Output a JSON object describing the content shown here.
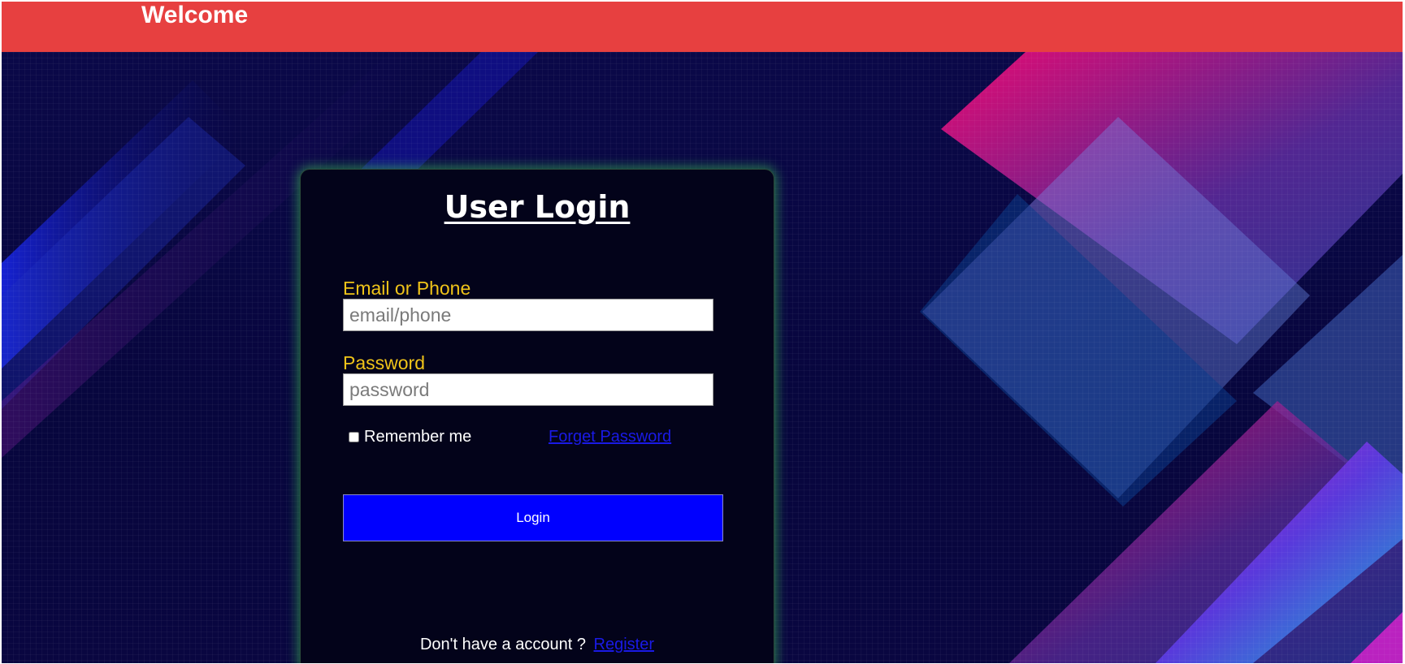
{
  "header": {
    "title": "Welcome"
  },
  "login_card": {
    "title": "User Login",
    "email": {
      "label": "Email or Phone",
      "placeholder": "email/phone",
      "value": ""
    },
    "password": {
      "label": "Password",
      "placeholder": "password",
      "value": ""
    },
    "remember_label": "Remember me",
    "remember_checked": false,
    "forgot_link": "Forget Password",
    "login_button": "Login",
    "signup_prompt": "Don't have a account ?",
    "register_link": "Register"
  },
  "colors": {
    "header_bg": "#e74040",
    "label_color": "#f0c419",
    "button_bg": "#0000ff",
    "link_color": "#1a1ae6",
    "card_glow": "#3cc850"
  }
}
